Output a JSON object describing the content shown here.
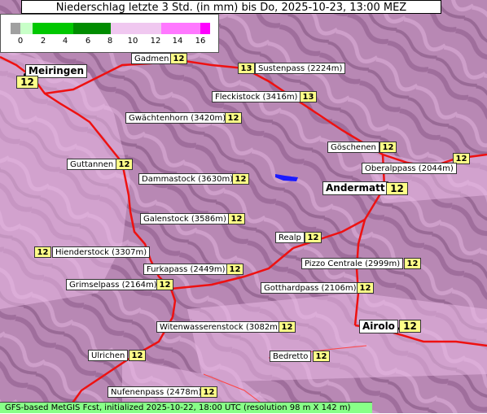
{
  "title": "Niederschlag letzte 3 Std. (in mm) bis Do, 2025-10-23, 13:00 MEZ",
  "legend": {
    "ticks": [
      "0",
      "2",
      "4",
      "6",
      "8",
      "10",
      "12",
      "14",
      "16"
    ],
    "colors": [
      "#a0a0a0",
      "#c8ffc8",
      "#00c800",
      "#008c00",
      "#f0c8f0",
      "#ff78ff",
      "#ff00ff"
    ]
  },
  "places": [
    {
      "name": "Meiringen",
      "value": "12"
    },
    {
      "name": "Gadmen",
      "value": "12"
    },
    {
      "name": "Sustenpass (2224m)",
      "value": "13"
    },
    {
      "name": "Fleckistock (3416m)",
      "value": "13"
    },
    {
      "name": "Gwächtenhorn (3420m)",
      "value": "12"
    },
    {
      "name": "Göschenen",
      "value": "12"
    },
    {
      "name": "Oberalppass (2044m)",
      "value": "12"
    },
    {
      "name": "Guttannen",
      "value": "12"
    },
    {
      "name": "Dammastock (3630m)",
      "value": "12"
    },
    {
      "name": "Andermatt",
      "value": "12"
    },
    {
      "name": "Galenstock (3586m)",
      "value": "12"
    },
    {
      "name": "Realp",
      "value": "12"
    },
    {
      "name": "Hienderstock (3307m)",
      "value": "12"
    },
    {
      "name": "Pizzo Centrale (2999m)",
      "value": "12"
    },
    {
      "name": "Furkapass (2449m)",
      "value": "12"
    },
    {
      "name": "Grimselpass (2164m)",
      "value": "12"
    },
    {
      "name": "Gotthardpass (2106m)",
      "value": "12"
    },
    {
      "name": "Airolo",
      "value": "12"
    },
    {
      "name": "Witenwasserenstock (3082m)",
      "value": "12"
    },
    {
      "name": "Ulrichen",
      "value": "12"
    },
    {
      "name": "Bedretto",
      "value": "12"
    },
    {
      "name": "Nufenenpass (2478m)",
      "value": "12"
    }
  ],
  "footer": "GFS-based MetGIS Fcst, initialized 2025-10-22, 18:00 UTC  (resolution 98 m X 142 m)"
}
